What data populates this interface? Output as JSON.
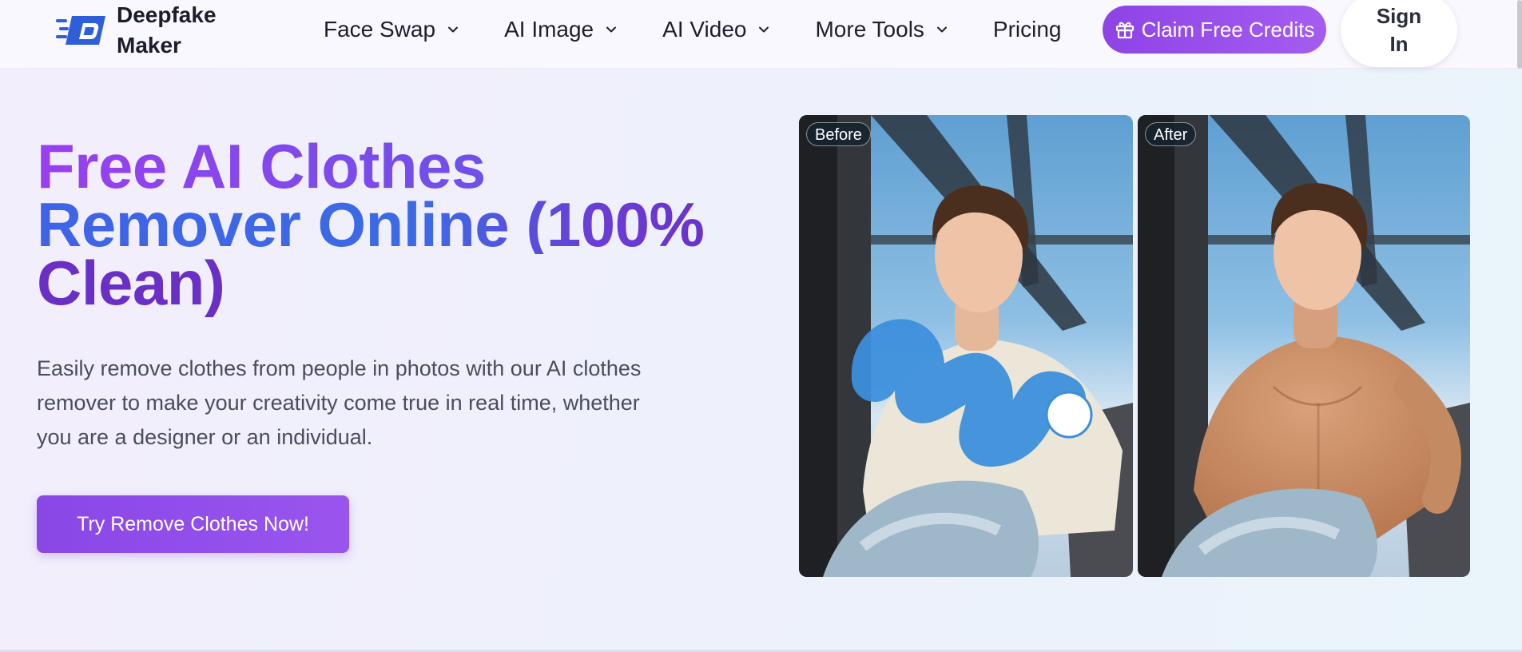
{
  "brand": {
    "name_line1": "Deepfake",
    "name_line2": "Maker",
    "icon": "df-logo-icon"
  },
  "nav": {
    "items": [
      {
        "label": "Face Swap",
        "has_dropdown": true
      },
      {
        "label": "AI Image",
        "has_dropdown": true
      },
      {
        "label": "AI Video",
        "has_dropdown": true
      },
      {
        "label": "More Tools",
        "has_dropdown": true
      },
      {
        "label": "Pricing",
        "has_dropdown": false
      }
    ],
    "claim_label": "Claim Free Credits",
    "claim_icon": "gift-icon",
    "signin_line1": "Sign",
    "signin_line2": "In"
  },
  "hero": {
    "title_line1": "Free AI Clothes",
    "title_line2": "Remover Online (100%",
    "title_line3": "Clean)",
    "description": "Easily remove clothes from people in photos with our AI clothes remover to make your creativity come true in real time, whether you are a designer or an individual.",
    "cta_label": "Try Remove Clothes Now!"
  },
  "compare": {
    "before_label": "Before",
    "after_label": "After"
  },
  "colors": {
    "accent": "#9a55ee",
    "title_purple": "#9a3ff0",
    "title_blue": "#3f63e8",
    "brush_blue": "#3d8fdc"
  }
}
